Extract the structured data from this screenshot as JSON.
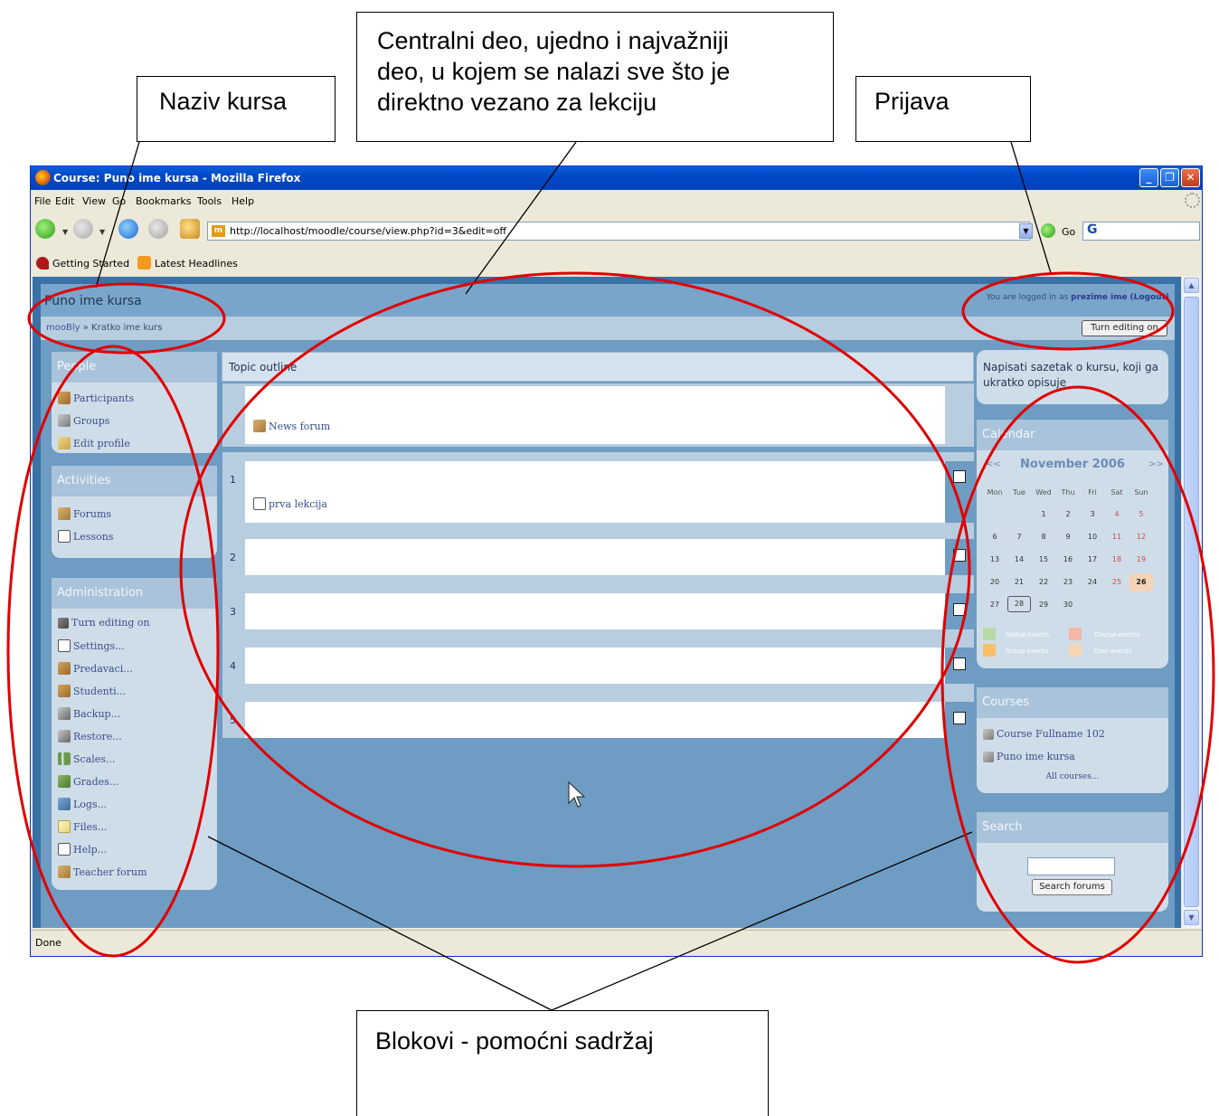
{
  "callouts": {
    "central": [
      "Centralni deo, ujedno i najvažniji",
      "deo, u kojem se nalazi sve što je",
      "direktno vezano za lekciju"
    ],
    "naziv": "Naziv kursa",
    "prijava": "Prijava",
    "blokovi": "Blokovi - pomoćni sadržaj"
  },
  "browser": {
    "window_title": "Course: Puno ime kursa - Mozilla Firefox",
    "menu": [
      "File",
      "Edit",
      "View",
      "Go",
      "Bookmarks",
      "Tools",
      "Help"
    ],
    "url": "http://localhost/moodle/course/view.php?id=3&edit=off",
    "go_label": "Go",
    "search_engine_glyph": "G",
    "bookmarks": [
      "Getting Started",
      "Latest Headlines"
    ],
    "status": "Done",
    "icons": [
      "firefox-icon",
      "back-icon",
      "forward-icon",
      "reload-icon",
      "stop-icon",
      "home-icon",
      "go-icon",
      "throbber-icon"
    ]
  },
  "page": {
    "course_fullname": "Puno ime kursa",
    "login_prefix": "You are logged in as ",
    "login_user": "prezime ime",
    "logout": "(Logout)",
    "breadcrumb_root": "mooBly",
    "breadcrumb_sep": " » ",
    "breadcrumb_course": "Kratko ime kurs",
    "editing_button": "Turn editing on"
  },
  "left_blocks": {
    "people": {
      "title": "People",
      "items": [
        "Participants",
        "Groups",
        "Edit profile"
      ]
    },
    "activities": {
      "title": "Activities",
      "items": [
        "Forums",
        "Lessons"
      ]
    },
    "administration": {
      "title": "Administration",
      "items": [
        "Turn editing on",
        "Settings...",
        "Predavaci...",
        "Studenti...",
        "Backup...",
        "Restore...",
        "Scales...",
        "Grades...",
        "Logs...",
        "Files...",
        "Help...",
        "Teacher forum"
      ]
    }
  },
  "topics": {
    "title": "Topic outline",
    "section0_link": "News forum",
    "sections": [
      {
        "num": "1",
        "link": "prva lekcija"
      },
      {
        "num": "2",
        "link": ""
      },
      {
        "num": "3",
        "link": ""
      },
      {
        "num": "4",
        "link": ""
      },
      {
        "num": "5",
        "link": ""
      }
    ]
  },
  "right_blocks": {
    "summary": "Napisati sazetak o kursu, koji ga ukratko opisuje",
    "calendar": {
      "title": "Calendar",
      "prev": "<<",
      "next": ">>",
      "month": "November 2006",
      "dow": [
        "Mon",
        "Tue",
        "Wed",
        "Thu",
        "Fri",
        "Sat",
        "Sun"
      ],
      "weeks": [
        [
          "",
          "",
          "1",
          "2",
          "3",
          "4",
          "5"
        ],
        [
          "6",
          "7",
          "8",
          "9",
          "10",
          "11",
          "12"
        ],
        [
          "13",
          "14",
          "15",
          "16",
          "17",
          "18",
          "19"
        ],
        [
          "20",
          "21",
          "22",
          "23",
          "24",
          "25",
          "26"
        ],
        [
          "27",
          "28",
          "29",
          "30",
          "",
          "",
          ""
        ]
      ],
      "today": "26",
      "selected": "28",
      "legend": [
        "Global events",
        "Course events",
        "Group events",
        "User events"
      ],
      "legend_colors": [
        "#b9d9a8",
        "#f4b7a8",
        "#f6c06a",
        "#f6d7b5"
      ]
    },
    "courses": {
      "title": "Courses",
      "items": [
        "Course Fullname 102",
        "Puno ime kursa"
      ],
      "all": "All courses..."
    },
    "search": {
      "title": "Search",
      "button": "Search forums"
    }
  }
}
